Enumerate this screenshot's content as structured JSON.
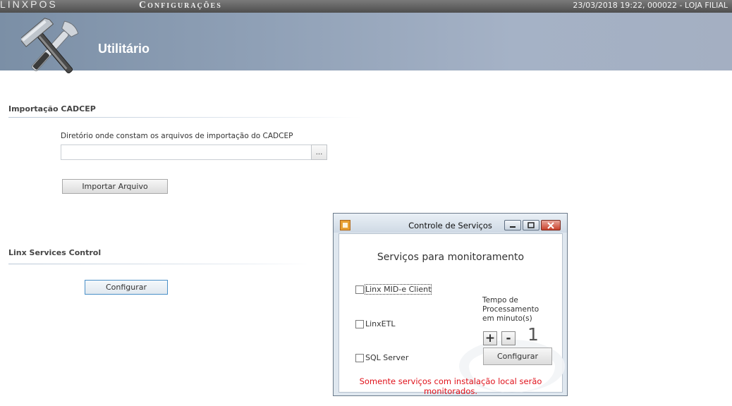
{
  "app": {
    "logo": "LINXPOS",
    "screen_title": "Configurações",
    "status": "23/03/2018 19:22, 000022 - LOJA FILIAL"
  },
  "header": {
    "title": "Utilitário",
    "icon": "hammer-wrench-icon"
  },
  "import_section": {
    "title": "Importação CADCEP",
    "dir_label": "Diretório onde constam os arquivos de importação do CADCEP",
    "dir_value": "",
    "browse_label": "...",
    "import_button": "Importar Arquivo"
  },
  "services_section": {
    "title": "Linx Services Control",
    "configure_button": "Configurar"
  },
  "dialog": {
    "title": "Controle de Serviços",
    "heading": "Serviços para monitoramento",
    "services": [
      {
        "label": "Linx MID-e Client",
        "checked": false
      },
      {
        "label": "LinxETL",
        "checked": false
      },
      {
        "label": "SQL Server",
        "checked": false
      }
    ],
    "tempo_label": "Tempo de Processamento em minuto(s)",
    "plus": "+",
    "minus": "-",
    "interval": "1",
    "configure_button": "Configurar",
    "warning": "Somente serviços com instalação local serão monitorados.",
    "warning_color": "#e0121b"
  }
}
